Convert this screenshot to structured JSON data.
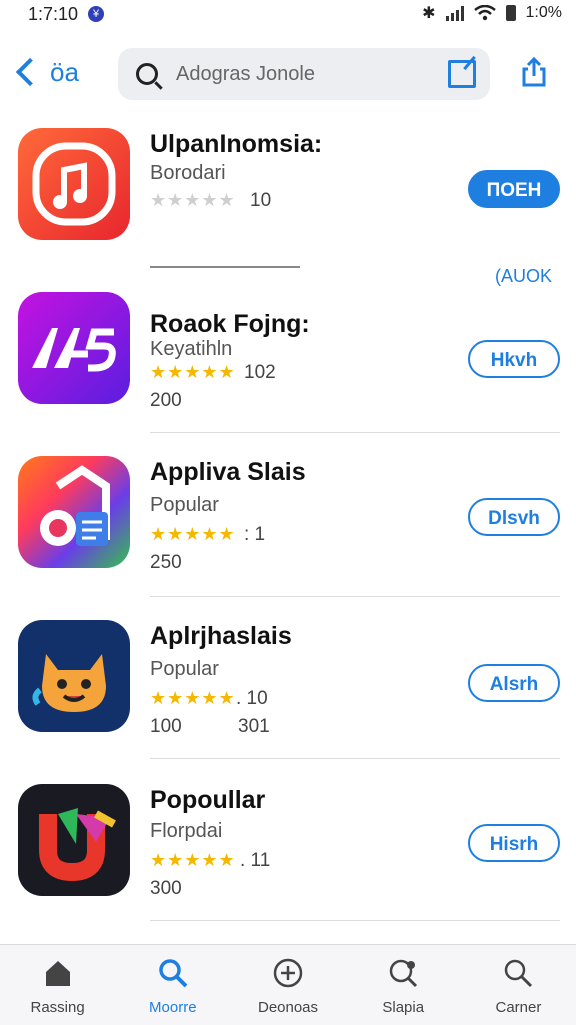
{
  "status": {
    "time": "1:7:10",
    "badge": "¥",
    "bluetooth": "✱",
    "battery": "1:0%"
  },
  "nav": {
    "back_label": "öa",
    "search_placeholder": "Adogras Jonole",
    "edit_icon": "edit-icon",
    "share_icon": "share-icon"
  },
  "apps": [
    {
      "title": "UlpanInomsia:",
      "subtitle": "Borodari",
      "stars_filled": 0,
      "rating": "10",
      "meta": "",
      "meta2": "",
      "button": "ПОЕН",
      "button_filled": true
    },
    {
      "title": "Roaok Fojng:",
      "subtitle": "Keyatihln",
      "stars_filled": 5,
      "rating": "102",
      "meta": "200",
      "meta2": "",
      "button": "Hkvh",
      "button_filled": false
    },
    {
      "title": "Appliva Slais",
      "subtitle": "Popular",
      "stars_filled": 5,
      "rating": ": 1",
      "meta": "250",
      "meta2": "",
      "button": "Dlsvh",
      "button_filled": false
    },
    {
      "title": "Aplrjhaslais",
      "subtitle": "Popular",
      "stars_filled": 5,
      "rating": ". 10",
      "meta": "100",
      "meta2": "301",
      "button": "Alsrh",
      "button_filled": false
    },
    {
      "title": "Popoullar",
      "subtitle": "Florpdai",
      "stars_filled": 5,
      "rating": ". 11",
      "meta": "300",
      "meta2": "",
      "button": "Hisrh",
      "button_filled": false
    }
  ],
  "section_link": "(AUOK",
  "tabs": [
    {
      "label": "Rassing",
      "icon": "home-icon",
      "active": false
    },
    {
      "label": "Moorre",
      "icon": "search-icon",
      "active": true
    },
    {
      "label": "Deonoas",
      "icon": "add-icon",
      "active": false
    },
    {
      "label": "Slapia",
      "icon": "search-plus-icon",
      "active": false
    },
    {
      "label": "Carner",
      "icon": "search-icon",
      "active": false
    }
  ],
  "colors": {
    "accent": "#1e7fe0",
    "star": "#f5b800"
  }
}
